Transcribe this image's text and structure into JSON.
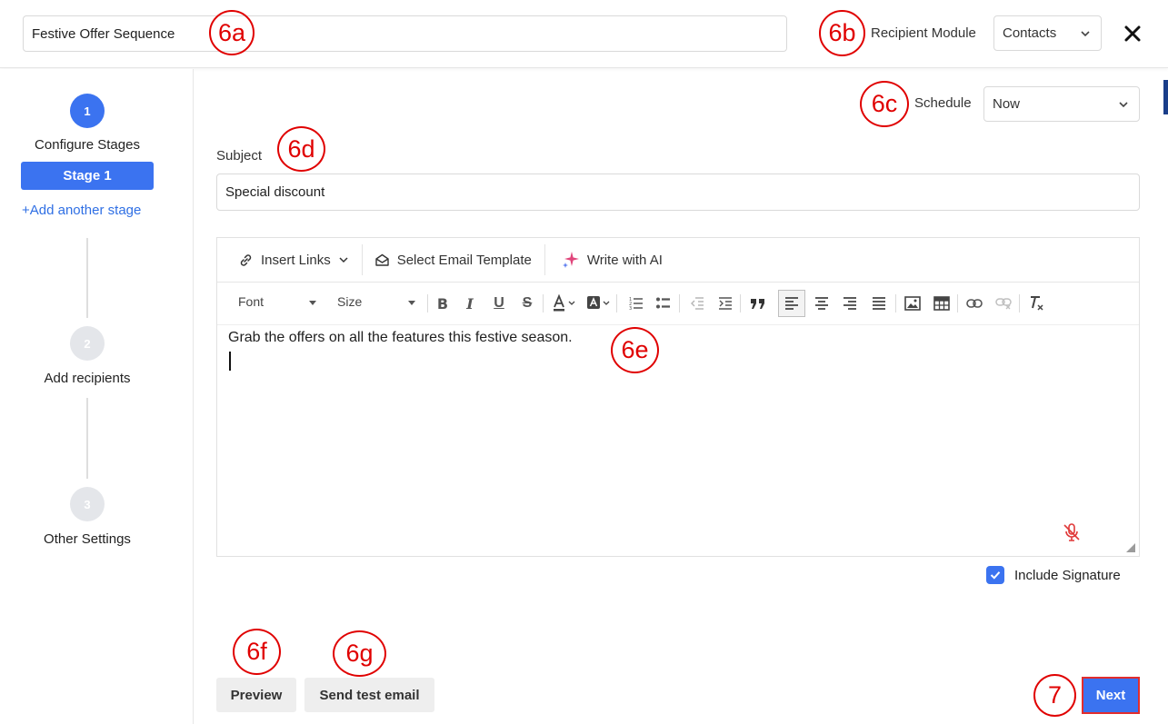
{
  "header": {
    "sequence_name_value": "Festive Offer Sequence",
    "recipient_module_label": "Recipient Module",
    "recipient_module_value": "Contacts"
  },
  "sidebar": {
    "steps": [
      {
        "number": "1",
        "label": "Configure Stages"
      },
      {
        "number": "2",
        "label": "Add recipients"
      },
      {
        "number": "3",
        "label": "Other Settings"
      }
    ],
    "stage_button": "Stage 1",
    "add_stage_link": "+Add another stage"
  },
  "schedule": {
    "label": "Schedule",
    "value": "Now"
  },
  "subject": {
    "label": "Subject",
    "value": "Special discount"
  },
  "editor": {
    "toolbar_primary": {
      "insert_links": "Insert Links",
      "select_template": "Select Email Template",
      "write_ai": "Write with AI"
    },
    "font_dropdown": "Font",
    "size_dropdown": "Size",
    "body_text": "Grab the offers on all the features this festive season."
  },
  "signature": {
    "label": "Include Signature",
    "checked": true
  },
  "buttons": {
    "preview": "Preview",
    "send_test": "Send test email",
    "next": "Next"
  },
  "annotations": [
    "6a",
    "6b",
    "6c",
    "6d",
    "6e",
    "6f",
    "6g",
    "7"
  ],
  "colors": {
    "accent": "#3b73f0",
    "annotation": "#e00000",
    "next_border": "#e22d2d"
  }
}
